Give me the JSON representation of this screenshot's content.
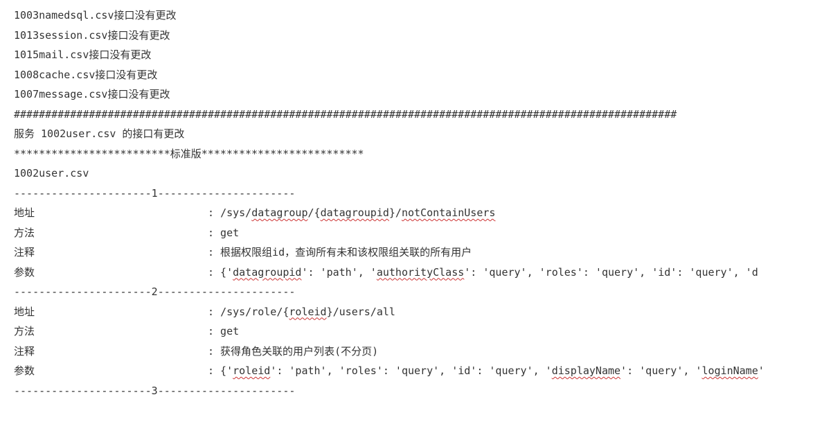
{
  "unchanged": [
    "1003namedsql.csv接口没有更改",
    "1013session.csv接口没有更改",
    "1015mail.csv接口没有更改",
    "1008cache.csv接口没有更改",
    "1007message.csv接口没有更改"
  ],
  "hash_divider": "##########################################################################################################",
  "changed_header": "服务 1002user.csv 的接口有更改",
  "edition_line": "*************************标准版**************************",
  "file_name": "1002user.csv",
  "sections": [
    {
      "divider": "----------------------1----------------------",
      "address_label": "地址",
      "address_colon": ": ",
      "address_parts": [
        "/sys/",
        "datagroup",
        "/{",
        "datagroupid",
        "}/",
        "notContainUsers"
      ],
      "method_label": "方法",
      "method_value": ": get",
      "comment_label": "注释",
      "comment_value": ": 根据权限组id，查询所有未和该权限组关联的所有用户",
      "params_label": "参数",
      "params_prefix": ": {'",
      "params_parts": [
        {
          "k": "datagroupid",
          "u": true
        },
        {
          "k": "': 'path', '",
          "u": false
        },
        {
          "k": "authorityClass",
          "u": true
        },
        {
          "k": "': 'query', 'roles': 'query', 'id': 'query', 'd",
          "u": false
        }
      ]
    },
    {
      "divider": "----------------------2----------------------",
      "address_label": "地址",
      "address_colon": ": ",
      "address_parts": [
        "/sys/role/{",
        "roleid",
        "}/users/all"
      ],
      "method_label": "方法",
      "method_value": ": get",
      "comment_label": "注释",
      "comment_value": ": 获得角色关联的用户列表(不分页)",
      "params_label": "参数",
      "params_prefix": ": {'",
      "params_parts": [
        {
          "k": "roleid",
          "u": true
        },
        {
          "k": "': 'path', 'roles': 'query', 'id': 'query', '",
          "u": false
        },
        {
          "k": "displayName",
          "u": true
        },
        {
          "k": "': 'query', '",
          "u": false
        },
        {
          "k": "loginName",
          "u": true
        },
        {
          "k": "'",
          "u": false
        }
      ]
    }
  ],
  "trailing_divider": "----------------------3----------------------"
}
